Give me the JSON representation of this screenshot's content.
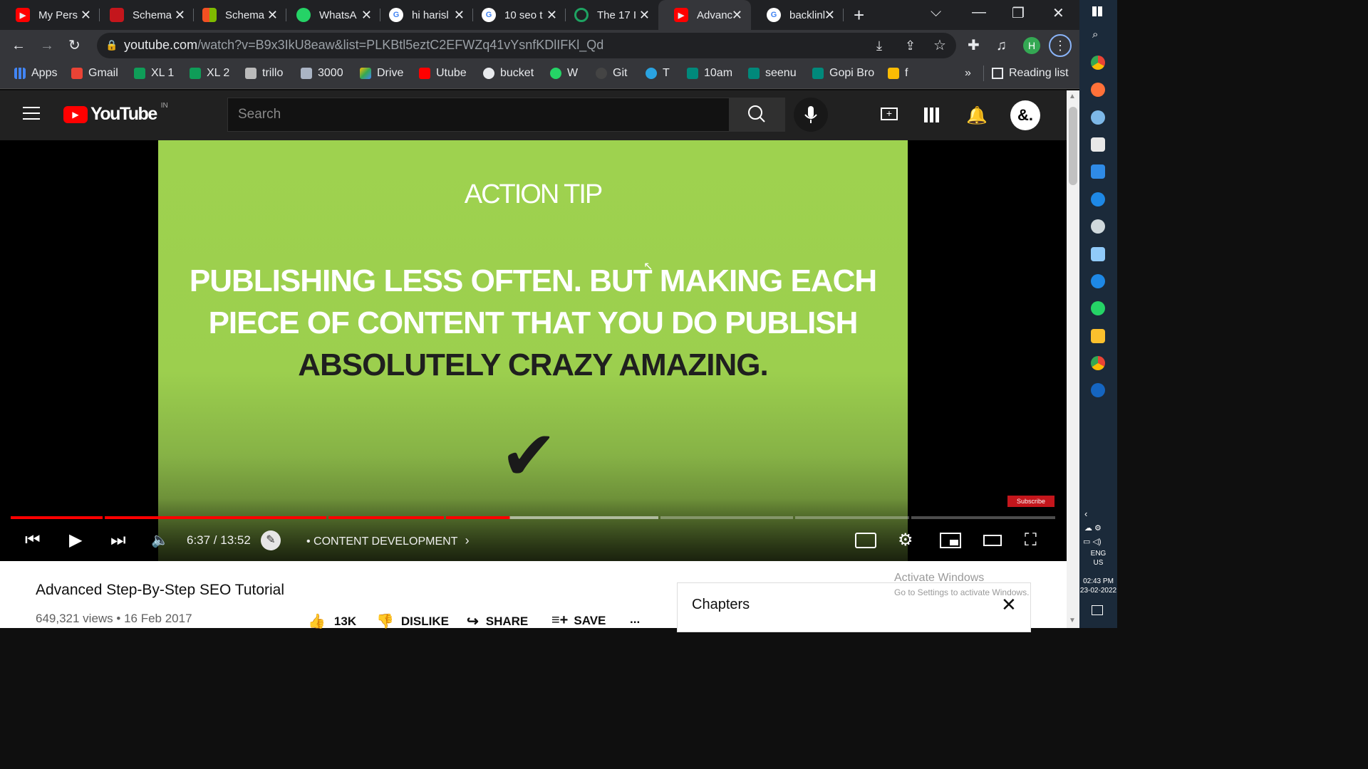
{
  "browser": {
    "tabs": [
      {
        "title": "My Pers",
        "favicon": "youtube-icon",
        "color": "#ff0000"
      },
      {
        "title": "Schema",
        "favicon": "schema-org-icon",
        "color": "#c4161c"
      },
      {
        "title": "Schema",
        "favicon": "microsoft-icon",
        "color": "#f25022"
      },
      {
        "title": "WhatsA",
        "favicon": "whatsapp-icon",
        "color": "#25d366"
      },
      {
        "title": "hi harisl",
        "favicon": "google-icon",
        "color": "#ffffff"
      },
      {
        "title": "10 seo t",
        "favicon": "google-icon",
        "color": "#ffffff"
      },
      {
        "title": "The 17 I",
        "favicon": "loading-icon",
        "color": "#1ea362"
      },
      {
        "title": "Advanc",
        "favicon": "youtube-icon",
        "color": "#ff0000",
        "active": true
      },
      {
        "title": "backlinl",
        "favicon": "google-icon",
        "color": "#ffffff"
      }
    ],
    "url_host": "youtube.com",
    "url_path": "/watch?v=B9x3IkU8eaw&list=PLKBtl5eztC2EFWZq41vYsnfKDlIFKl_Qd",
    "profile_initial": "H",
    "bookmarks": [
      {
        "label": "Apps",
        "color": "#4285f4"
      },
      {
        "label": "Gmail",
        "color": "#ea4335"
      },
      {
        "label": "XL 1",
        "color": "#0f9d58"
      },
      {
        "label": "XL 2",
        "color": "#0f9d58"
      },
      {
        "label": "trillo",
        "color": "#bbbbbb"
      },
      {
        "label": "3000",
        "color": "#aab4c4"
      },
      {
        "label": "Drive",
        "color": "#fbbc04"
      },
      {
        "label": "Utube",
        "color": "#ff0000"
      },
      {
        "label": "bucket",
        "color": "#e8eaed"
      },
      {
        "label": "W",
        "color": "#25d366"
      },
      {
        "label": "Git",
        "color": "#444444"
      },
      {
        "label": "T",
        "color": "#2aa3e0"
      },
      {
        "label": "10am",
        "color": "#00897b"
      },
      {
        "label": "seenu",
        "color": "#00897b"
      },
      {
        "label": "Gopi Bro",
        "color": "#00897b"
      },
      {
        "label": "f",
        "color": "#fbbc04"
      }
    ],
    "more_bookmarks": "»",
    "reading_list": "Reading list"
  },
  "youtube": {
    "logo_text": "YouTube",
    "region": "IN",
    "search_placeholder": "Search",
    "avatar_text": "&."
  },
  "video": {
    "tag": "ACTION TIP",
    "quote_line1": "PUBLISHING LESS OFTEN. BUT MAKING EACH",
    "quote_line2": "PIECE OF CONTENT THAT YOU DO PUBLISH",
    "quote_line3": "ABSOLUTELY CRAZY AMAZING.",
    "checkmark": "✔",
    "subscribe_badge": "Subscribe",
    "current_time": "6:37",
    "duration": "13:52",
    "time_display": "6:37 / 13:52",
    "progress_fraction": 0.478,
    "buffered_fraction": 0.62,
    "chapter": "• CONTENT DEVELOPMENT",
    "title": "Advanced Step-By-Step SEO Tutorial",
    "meta": "649,321 views • 16 Feb 2017",
    "likes": "13K",
    "dislike": "DISLIKE",
    "share": "SHARE",
    "save": "SAVE",
    "more": "..."
  },
  "chapters_panel": {
    "title": "Chapters"
  },
  "watermark": {
    "line1": "Activate Windows",
    "line2": "Go to Settings to activate Windows."
  },
  "taskbar": {
    "lang": "ENG",
    "region": "US",
    "time": "02:43 PM",
    "date": "23-02-2022"
  }
}
